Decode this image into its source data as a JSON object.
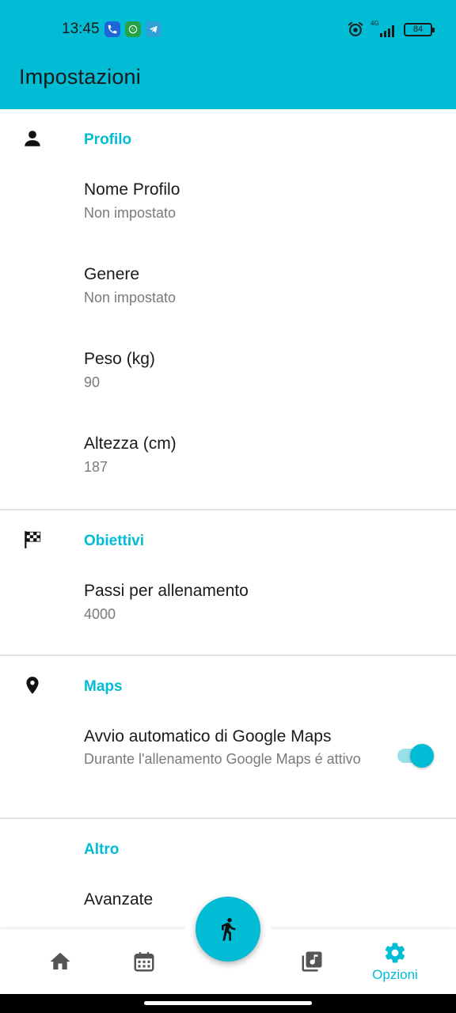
{
  "status_bar": {
    "time": "13:45",
    "signal_label": "4G",
    "battery": "84",
    "notification_icons": [
      "phone-icon",
      "whatsapp-icon",
      "telegram-icon"
    ]
  },
  "app_bar": {
    "title": "Impostazioni"
  },
  "sections": [
    {
      "title": "Profilo",
      "icon": "person-icon",
      "items": [
        {
          "title": "Nome Profilo",
          "value": "Non impostato"
        },
        {
          "title": "Genere",
          "value": "Non impostato"
        },
        {
          "title": "Peso (kg)",
          "value": "90"
        },
        {
          "title": "Altezza (cm)",
          "value": "187"
        }
      ]
    },
    {
      "title": "Obiettivi",
      "icon": "checkered-flag-icon",
      "items": [
        {
          "title": "Passi per allenamento",
          "value": "4000"
        }
      ]
    },
    {
      "title": "Maps",
      "icon": "location-pin-icon",
      "items": [
        {
          "title": "Avvio automatico di Google Maps",
          "value": "Durante l'allenamento Google Maps é attivo",
          "toggle": true
        }
      ]
    },
    {
      "title": "Altro",
      "items": [
        {
          "title": "Avanzate"
        }
      ]
    }
  ],
  "bottom_nav": {
    "items": [
      {
        "icon": "home-icon"
      },
      {
        "icon": "calendar-icon"
      },
      {
        "icon": "music-library-icon"
      },
      {
        "icon": "settings-gear-icon",
        "label": "Opzioni",
        "active": true
      }
    ],
    "fab_icon": "running-person-icon"
  },
  "colors": {
    "accent": "#00bcd4",
    "toggle_track": "#98dfe8",
    "text_primary": "#1a1a1a",
    "text_secondary": "#7a7a7a"
  }
}
